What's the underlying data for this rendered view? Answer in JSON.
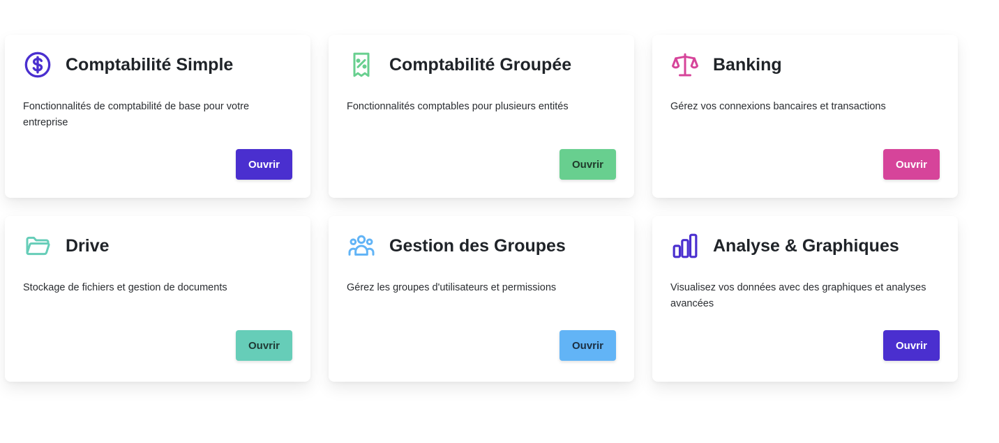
{
  "cards": [
    {
      "icon": "dollar-circle-icon",
      "icon_color": "#4a2fcf",
      "title": "Comptabilité Simple",
      "description": "Fonctionnalités de comptabilité de base pour votre entreprise",
      "button_label": "Ouvrir",
      "button_color": "#4a2fcf",
      "button_text_color": "#ffffff"
    },
    {
      "icon": "receipt-percent-icon",
      "icon_color": "#68cf8f",
      "title": "Comptabilité Groupée",
      "description": "Fonctionnalités comptables pour plusieurs entités",
      "button_label": "Ouvrir",
      "button_color": "#68cf8f",
      "button_text_color": "#1f3a2a"
    },
    {
      "icon": "scale-icon",
      "icon_color": "#d6449a",
      "title": "Banking",
      "description": "Gérez vos connexions bancaires et transactions",
      "button_label": "Ouvrir",
      "button_color": "#d6449a",
      "button_text_color": "#ffffff"
    },
    {
      "icon": "folder-open-icon",
      "icon_color": "#66cdb8",
      "title": "Drive",
      "description": "Stockage de fichiers et gestion de documents",
      "button_label": "Ouvrir",
      "button_color": "#66cdb8",
      "button_text_color": "#1f3a34"
    },
    {
      "icon": "user-group-icon",
      "icon_color": "#62b4f6",
      "title": "Gestion des Groupes",
      "description": "Gérez les groupes d'utilisateurs et permissions",
      "button_label": "Ouvrir",
      "button_color": "#62b4f6",
      "button_text_color": "#1b2f42"
    },
    {
      "icon": "bar-chart-icon",
      "icon_color": "#4a2fcf",
      "title": "Analyse & Graphiques",
      "description": "Visualisez vos données avec des graphiques et analyses avancées",
      "button_label": "Ouvrir",
      "button_color": "#4a2fcf",
      "button_text_color": "#ffffff"
    }
  ]
}
